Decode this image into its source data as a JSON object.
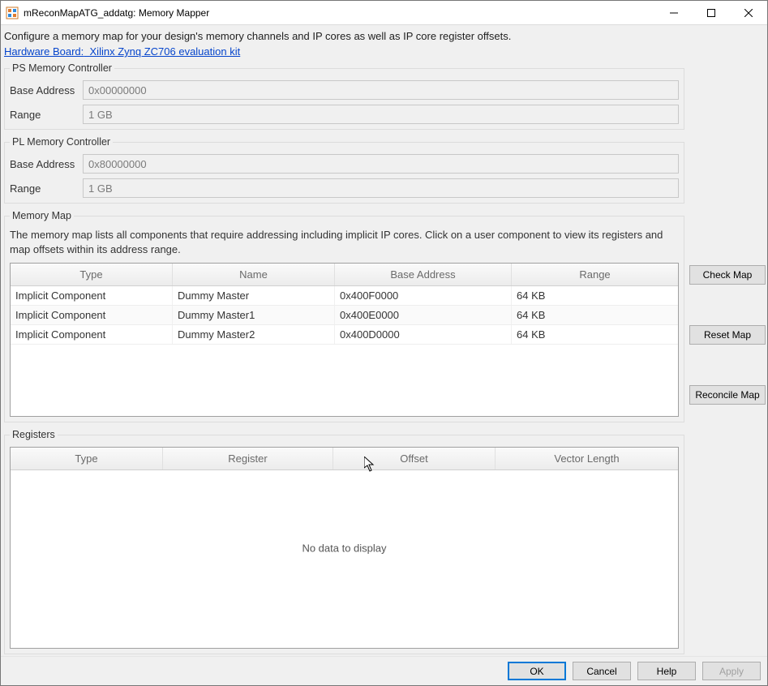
{
  "window": {
    "title": "mReconMapATG_addatg: Memory Mapper"
  },
  "intro": {
    "config_text": "Configure a memory map for your design's memory channels and IP cores as well as IP core register offsets.",
    "hw_link_label": "Hardware Board:",
    "hw_link_value": "Xilinx Zynq ZC706 evaluation kit"
  },
  "ps": {
    "legend": "PS Memory Controller",
    "base_label": "Base Address",
    "base_value": "0x00000000",
    "range_label": "Range",
    "range_value": "1 GB"
  },
  "pl": {
    "legend": "PL Memory Controller",
    "base_label": "Base Address",
    "base_value": "0x80000000",
    "range_label": "Range",
    "range_value": "1 GB"
  },
  "memmap": {
    "legend": "Memory Map",
    "desc": "The memory map lists all components that require addressing including implicit IP cores. Click on a user component to view its registers and map offsets within its address range.",
    "headers": [
      "Type",
      "Name",
      "Base Address",
      "Range"
    ],
    "rows": [
      {
        "type": "Implicit Component",
        "name": "Dummy Master",
        "base": "0x400F0000",
        "range": "64 KB"
      },
      {
        "type": "Implicit Component",
        "name": "Dummy Master1",
        "base": "0x400E0000",
        "range": "64 KB"
      },
      {
        "type": "Implicit Component",
        "name": "Dummy Master2",
        "base": "0x400D0000",
        "range": "64 KB"
      }
    ]
  },
  "registers": {
    "legend": "Registers",
    "headers": [
      "Type",
      "Register",
      "Offset",
      "Vector Length"
    ],
    "nodata": "No data to display"
  },
  "side_buttons": {
    "check": "Check Map",
    "reset": "Reset Map",
    "reconcile": "Reconcile Map"
  },
  "bottom_buttons": {
    "ok": "OK",
    "cancel": "Cancel",
    "help": "Help",
    "apply": "Apply"
  }
}
